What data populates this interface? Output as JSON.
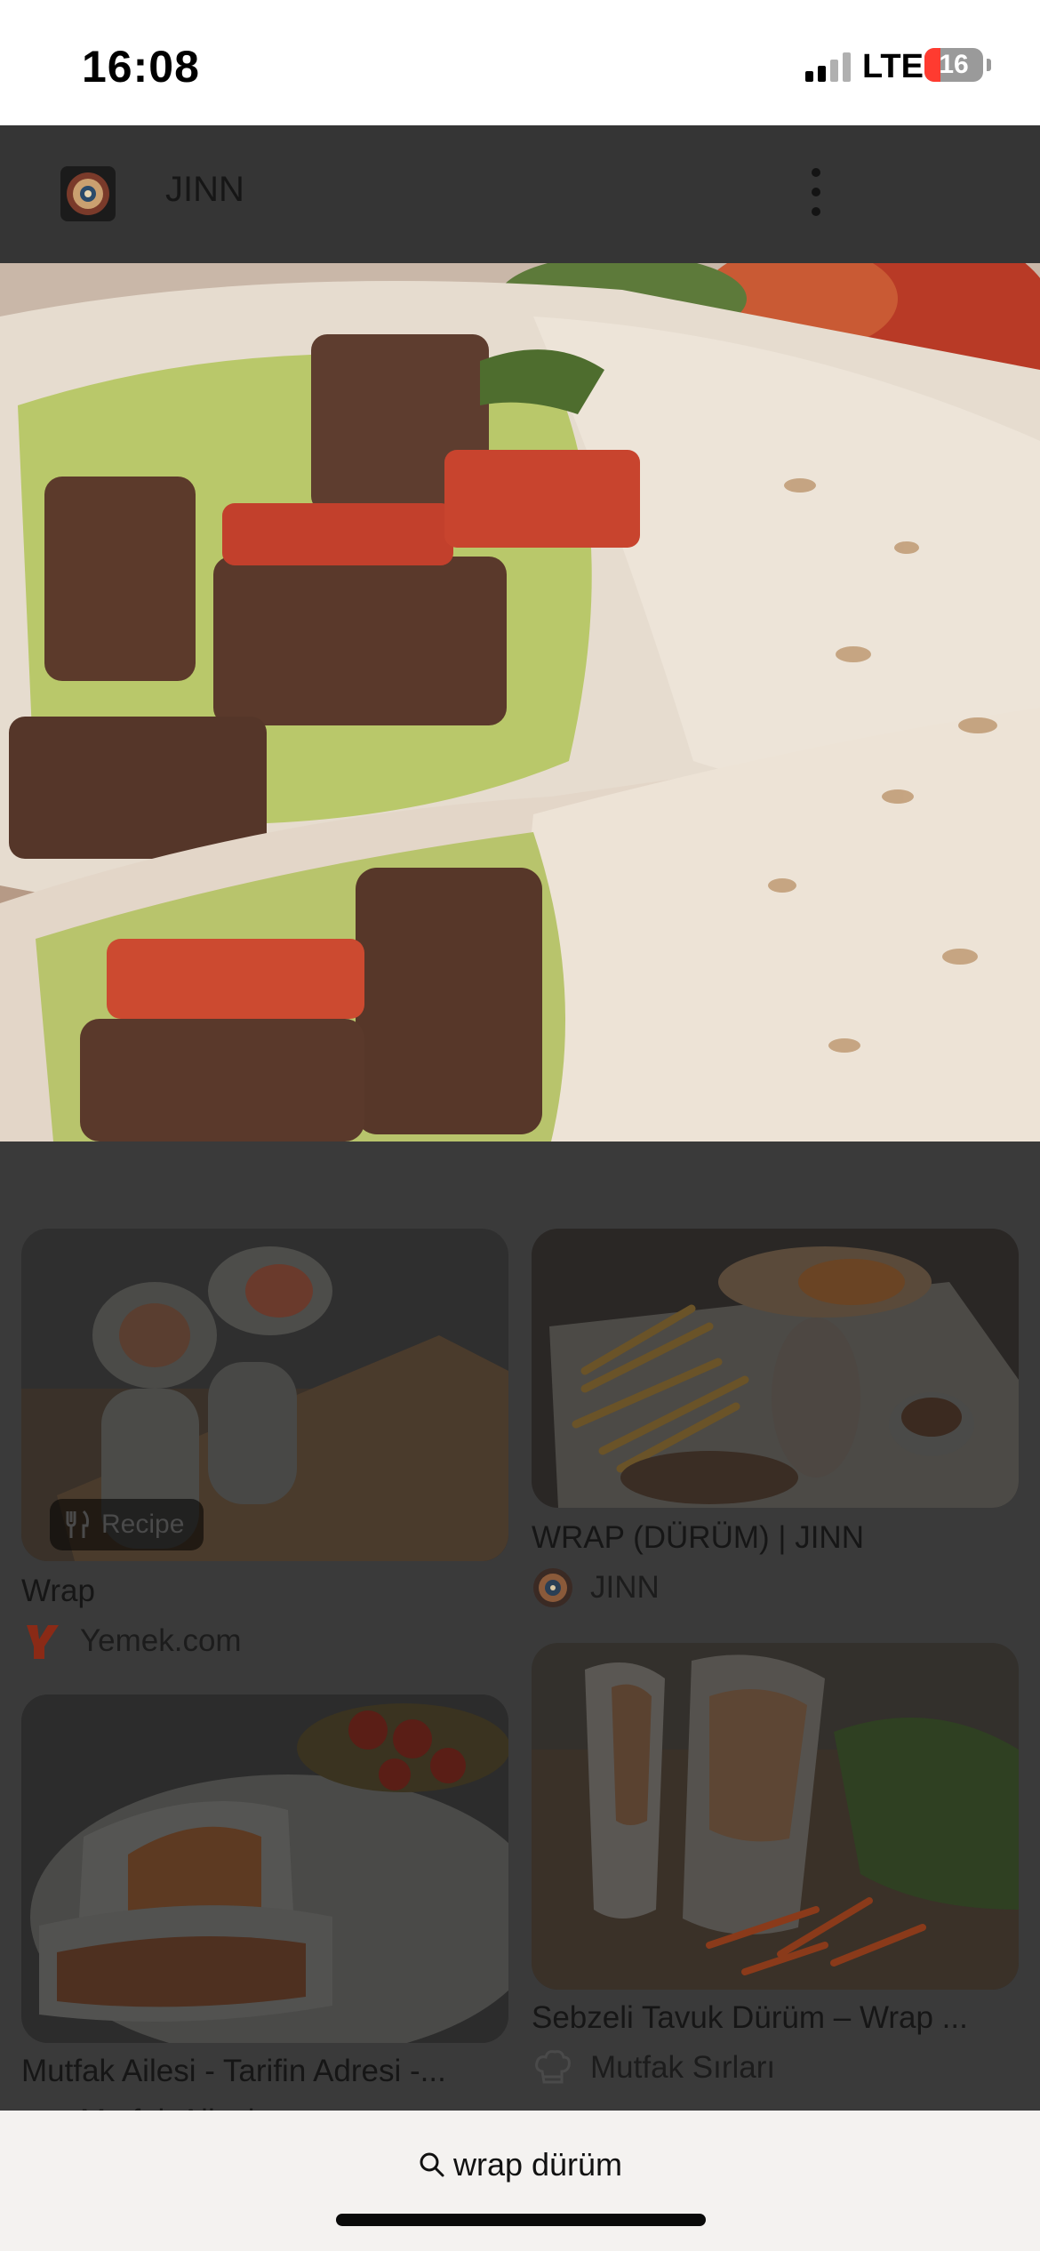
{
  "status": {
    "time": "16:08",
    "network": "LTE",
    "battery": "16"
  },
  "site": {
    "name": "JINN"
  },
  "results": [
    {
      "title": "Wrap",
      "source": "Yemek.com",
      "badge": "Recipe"
    },
    {
      "title": "WRAP (DÜRÜM) | JINN",
      "source": "JINN"
    },
    {
      "title": "Mutfak Ailesi - Tarifin Adresi -...",
      "source": "Mutfak Ailesi"
    },
    {
      "title": "Sebzeli Tavuk Dürüm – Wrap ...",
      "source": "Mutfak Sırları"
    }
  ],
  "search": {
    "query": "wrap dürüm"
  },
  "colors": {
    "overlay": "#3a3a3a",
    "status_bg": "#ffffff",
    "battery_low": "#ff3b30",
    "bottom_bar": "#f4f2f0"
  }
}
